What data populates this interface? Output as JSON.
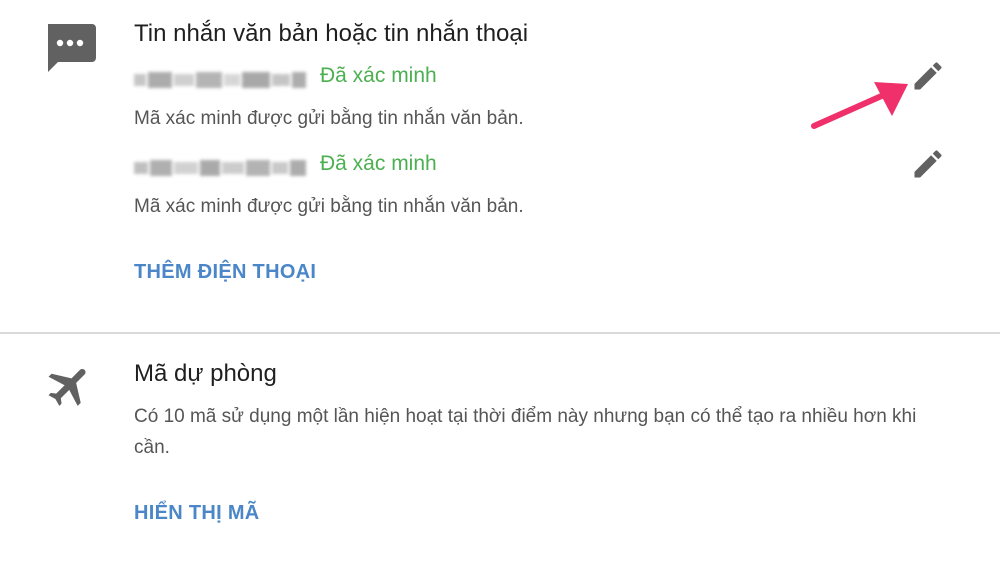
{
  "sms_section": {
    "icon": "message-icon",
    "title": "Tin nhắn văn bản hoặc tin nhắn thoại",
    "phones": [
      {
        "number_masked": "",
        "status": "Đã xác minh",
        "description": "Mã xác minh được gửi bằng tin nhắn văn bản."
      },
      {
        "number_masked": "",
        "status": "Đã xác minh",
        "description": "Mã xác minh được gửi bằng tin nhắn văn bản."
      }
    ],
    "add_phone_label": "THÊM ĐIỆN THOẠI"
  },
  "backup_section": {
    "icon": "airplane-icon",
    "title": "Mã dự phòng",
    "description": "Có 10 mã sử dụng một lần hiện hoạt tại thời điểm này nhưng bạn có thể tạo ra nhiều hơn khi cần.",
    "show_codes_label": "HIỂN THỊ MÃ"
  },
  "colors": {
    "verified": "#4caf50",
    "link": "#4a86c8",
    "icon": "#616161",
    "arrow": "#f0306a"
  }
}
